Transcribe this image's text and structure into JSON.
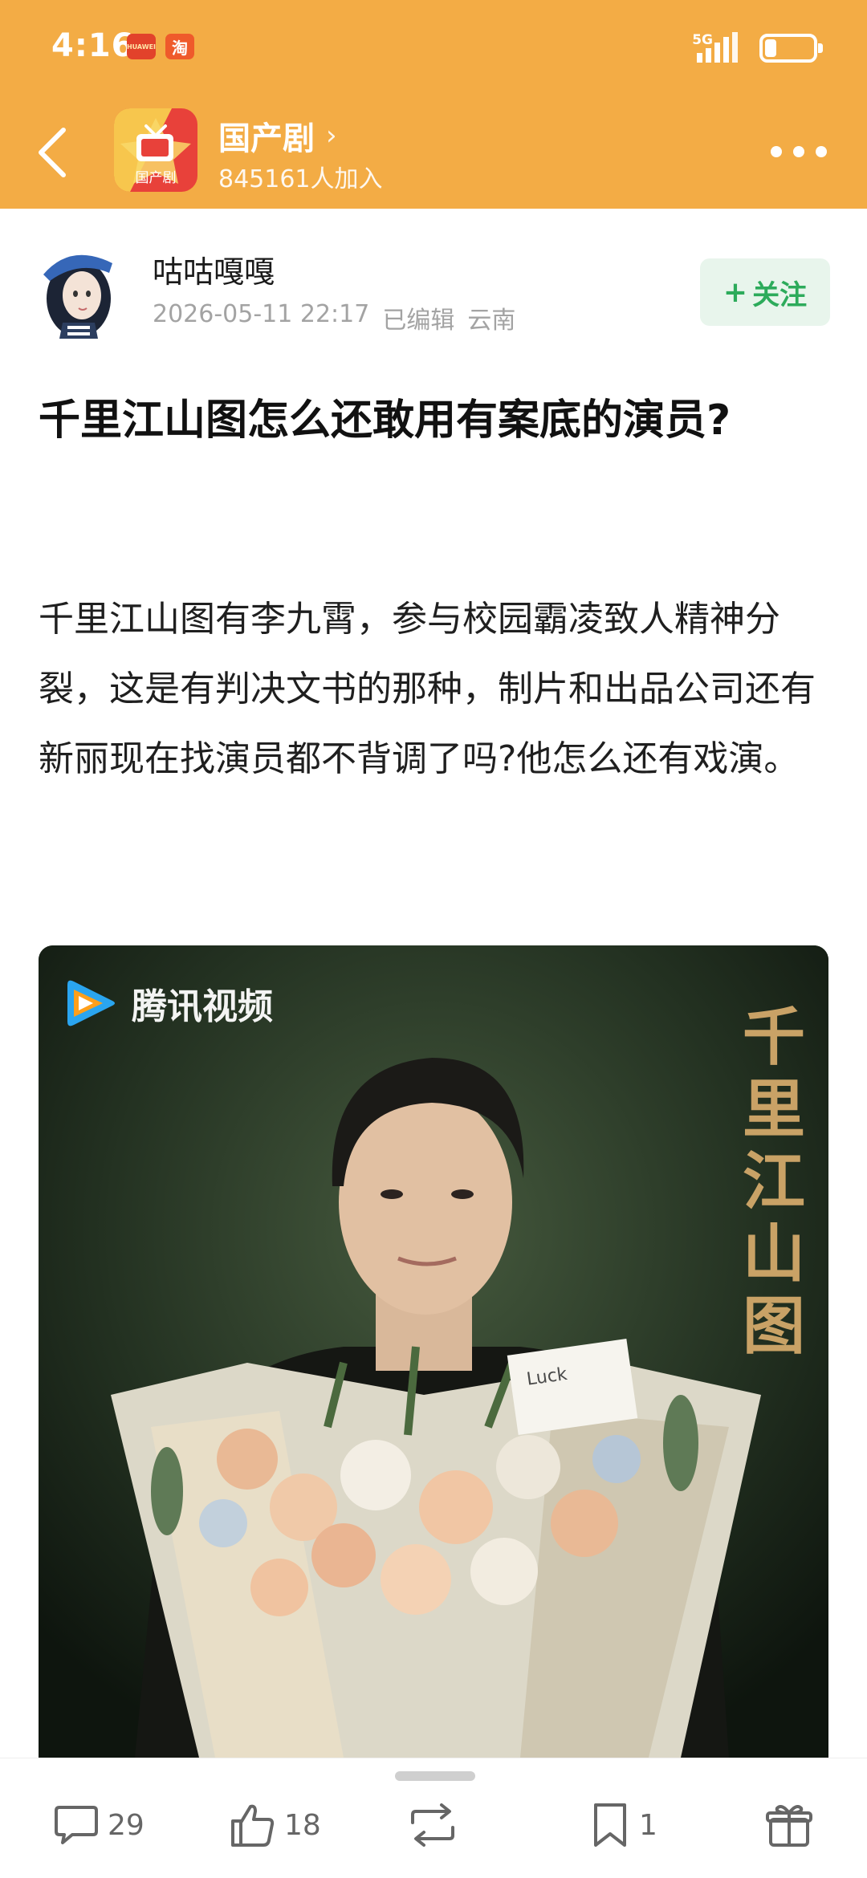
{
  "status_bar": {
    "time": "4:16",
    "notif_1": "HUAWEI",
    "notif_2": "淘",
    "network": "5G"
  },
  "nav": {
    "group_name": "国产剧",
    "group_members": "845161人加入",
    "logo_text": "国产剧"
  },
  "author": {
    "name": "咕咕嘎嘎",
    "date": "2026-05-11 22:17",
    "edited": "已编辑",
    "location": "云南",
    "follow_label": "关注"
  },
  "post": {
    "title": "千里江山图怎么还敢用有案底的演员?",
    "body": "千里江山图有李九霄，参与校园霸凌致人精神分裂，这是有判决文书的那种，制片和出品公司还有新丽现在找演员都不背调了吗?他怎么还有戏演。"
  },
  "image": {
    "watermark": "腾讯视频",
    "drama_logo": [
      "千",
      "里",
      "江",
      "山",
      "图"
    ],
    "card_text": "Luck"
  },
  "actions": {
    "comments": "29",
    "likes": "18",
    "favorites": "1"
  },
  "colors": {
    "header": "#f3ac45",
    "follow_text": "#2dab5b",
    "follow_bg": "#e8f5ec"
  }
}
